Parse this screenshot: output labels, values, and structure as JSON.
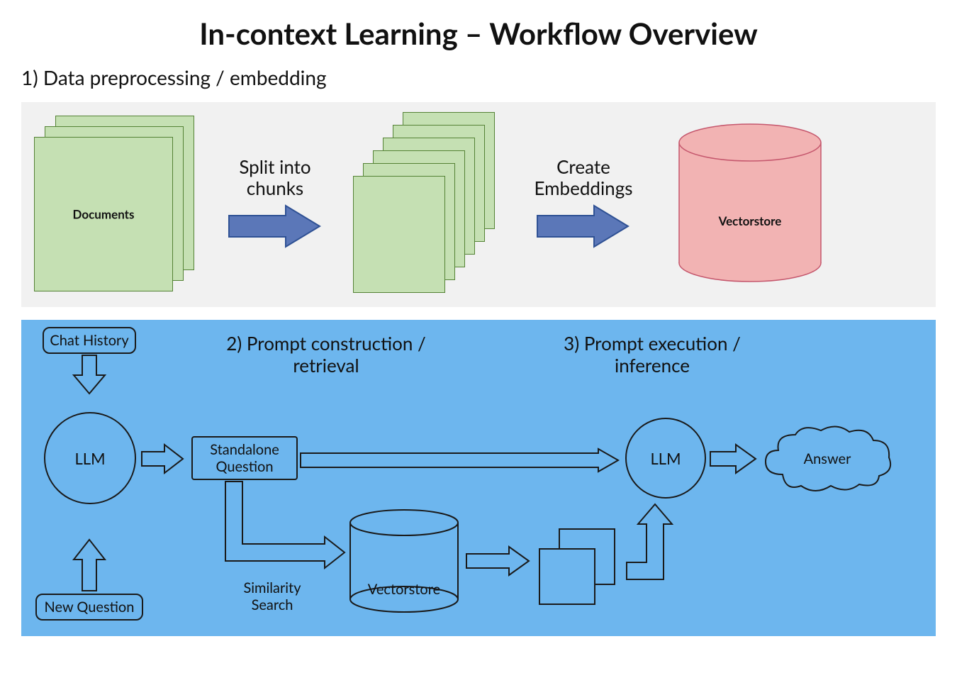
{
  "title": "In-context Learning – Workflow Overview",
  "step1": {
    "heading": "1) Data preprocessing / embedding",
    "documents_label": "Documents",
    "arrow1_label": "Split into\nchunks",
    "arrow2_label": "Create\nEmbeddings",
    "vectorstore_label": "Vectorstore"
  },
  "step2_title": "2) Prompt construction /\nretrieval",
  "step3_title": "3) Prompt execution /\ninference",
  "nodes": {
    "chat_history": "Chat History",
    "new_question": "New Question",
    "llm1": "LLM",
    "standalone_question": "Standalone\nQuestion",
    "similarity_search": "Similarity\nSearch",
    "vectorstore": "Vectorstore",
    "llm2": "LLM",
    "answer": "Answer"
  },
  "colors": {
    "doc_fill": "#c5e0b3",
    "doc_stroke": "#548235",
    "arrow_fill": "#5b77b8",
    "arrow_stroke": "#2f5194",
    "cyl_fill": "#f2b3b3",
    "cyl_stroke": "#c5576d",
    "panel_gray": "#f1f1f1",
    "panel_blue": "#6db6ee",
    "outline": "#1a1a1a"
  }
}
